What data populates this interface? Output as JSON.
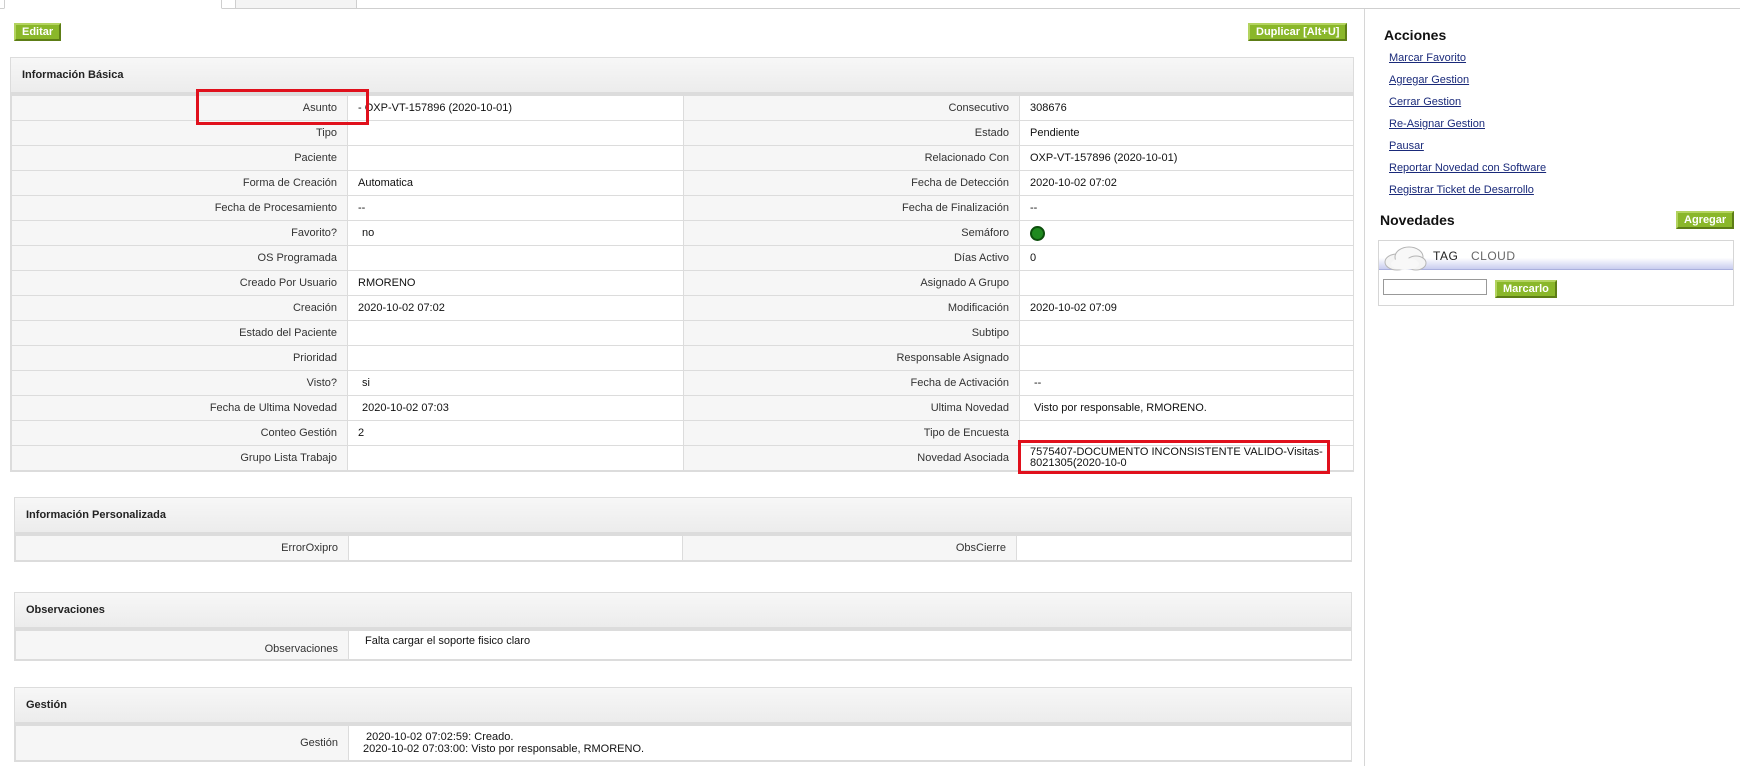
{
  "toolbar": {
    "edit_label": "Editar",
    "duplicate_label": "Duplicar [Alt+U]"
  },
  "basic": {
    "title": "Información Básica",
    "rows": [
      [
        "Asunto",
        "- OXP-VT-157896 (2020-10-01)",
        "Consecutivo",
        "308676"
      ],
      [
        "Tipo",
        "",
        "Estado",
        "Pendiente"
      ],
      [
        "Paciente",
        "",
        "Relacionado Con",
        "OXP-VT-157896 (2020-10-01)"
      ],
      [
        "Forma de Creación",
        "Automatica",
        "Fecha de Detección",
        "2020-10-02 07:02"
      ],
      [
        "Fecha de Procesamiento",
        "--",
        "Fecha de Finalización",
        "--"
      ],
      [
        "Favorito?",
        "no",
        "Semáforo",
        ""
      ],
      [
        "OS Programada",
        "",
        "Días Activo",
        "0"
      ],
      [
        "Creado Por Usuario",
        "RMORENO",
        "Asignado A Grupo",
        ""
      ],
      [
        "Creación",
        "2020-10-02 07:02",
        "Modificación",
        "2020-10-02 07:09"
      ],
      [
        "Estado del Paciente",
        "",
        "Subtipo",
        ""
      ],
      [
        "Prioridad",
        "",
        "Responsable Asignado",
        ""
      ],
      [
        "Visto?",
        "si",
        "Fecha de Activación",
        "--"
      ],
      [
        "Fecha de Ultima Novedad",
        "2020-10-02 07:03",
        "Ultima Novedad",
        "Visto por responsable, RMORENO."
      ],
      [
        "Conteo Gestión",
        "2",
        "Tipo de Encuesta",
        ""
      ],
      [
        "Grupo Lista Trabajo",
        "",
        "Novedad Asociada",
        ""
      ]
    ],
    "novedad_asociada_line1": "7575407-DOCUMENTO INCONSISTENTE VALIDO-Visitas-",
    "novedad_asociada_line2": "8021305(2020-10-0",
    "semaforo_color": "#1f8a1f"
  },
  "personalizada": {
    "title": "Información Personalizada",
    "label1": "ErrorOxipro",
    "value1": "",
    "label2": "ObsCierre",
    "value2": ""
  },
  "observaciones": {
    "title": "Observaciones",
    "label": "Observaciones",
    "value": "Falta cargar el soporte fisico claro"
  },
  "gestion": {
    "title": "Gestión",
    "label": "Gestión",
    "line1": "2020-10-02 07:02:59: Creado.",
    "line2": "2020-10-02 07:03:00: Visto por responsable, RMORENO."
  },
  "side": {
    "acciones_title": "Acciones",
    "acciones": [
      "Marcar Favorito",
      "Agregar Gestion",
      "Cerrar Gestion",
      "Re-Asignar Gestion",
      "Pausar",
      "Reportar Novedad con Software",
      "Registrar Ticket de Desarrollo"
    ],
    "novedades_title": "Novedades",
    "agregar_label": "Agregar",
    "tagcloud_tag": "TAG",
    "tagcloud_cloud": "CLOUD",
    "marcarlo_label": "Marcarlo",
    "marcarlo_value": ""
  },
  "colors": {
    "button_green": "#8ab72a",
    "highlight_red": "#e0101c",
    "link_blue": "#1a2a7a"
  }
}
